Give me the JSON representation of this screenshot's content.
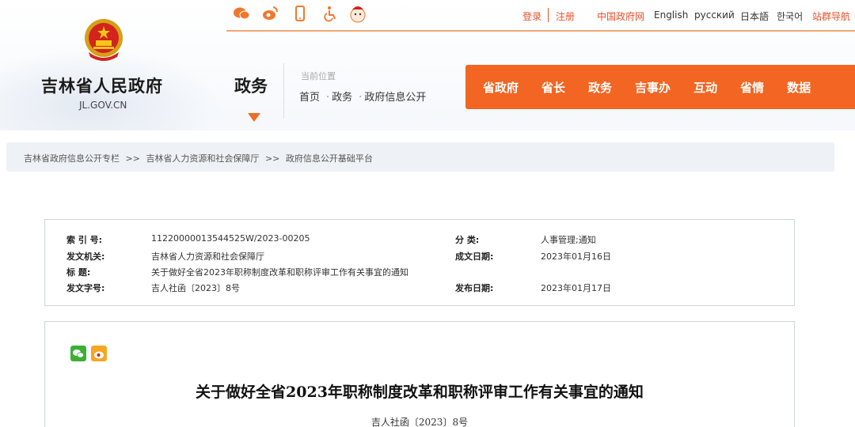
{
  "site": {
    "name": "吉林省人民政府",
    "domain": "JL.GOV.CN",
    "section": "政务"
  },
  "topbar": {
    "icons": [
      "weibo-chat-icon",
      "weibo-icon",
      "mobile-icon",
      "accessibility-icon",
      "mascot-icon"
    ],
    "login": "登录",
    "register": "注册",
    "links": [
      "中国政府网",
      "English",
      "русский",
      "日本語",
      "한국어",
      "站群导航"
    ]
  },
  "location": {
    "label": "当前位置",
    "crumbs": [
      "首页",
      "政务",
      "政府信息公开"
    ]
  },
  "mainnav": [
    "省政府",
    "省长",
    "政务",
    "吉事办",
    "互动",
    "省情",
    "数据"
  ],
  "breadcrumb": [
    "吉林省政府信息公开专栏",
    ">>",
    "吉林省人力资源和社会保障厅",
    ">>",
    "政府信息公开基础平台"
  ],
  "info": {
    "index_label": "索 引 号:",
    "index_value": "11220000013544525W/2023-00205",
    "category_label": "分      类:",
    "category_value": "人事管理;通知",
    "issuer_label": "发文机关:",
    "issuer_value": "吉林省人力资源和社会保障厅",
    "date_written_label": "成文日期:",
    "date_written_value": "2023年01月16日",
    "title_label": "标      题:",
    "title_value": "关于做好全省2023年职称制度改革和职称评审工作有关事宜的通知",
    "docno_label": "发文字号:",
    "docno_value": "吉人社函〔2023〕8号",
    "pubdate_label": "发布日期:",
    "pubdate_value": "2023年01月17日"
  },
  "document": {
    "title": "关于做好全省2023年职称制度改革和职称评审工作有关事宜的通知",
    "number": "吉人社函〔2023〕8号"
  },
  "colors": {
    "accent": "#f26522",
    "link_red": "#e8502b"
  }
}
